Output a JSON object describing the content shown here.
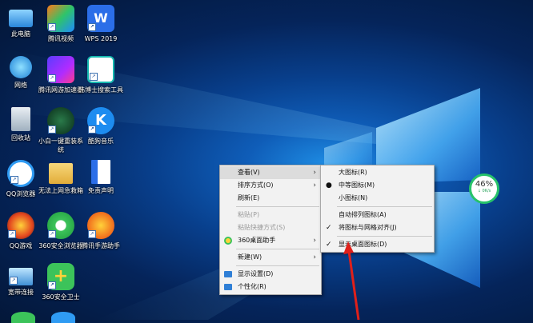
{
  "desktop_icons": [
    {
      "label": "此电脑"
    },
    {
      "label": "腾讯视频"
    },
    {
      "label": "WPS 2019"
    },
    {
      "label": "网络"
    },
    {
      "label": "腾讯网游加速器"
    },
    {
      "label": "韩博士搜索工具"
    },
    {
      "label": "回收站"
    },
    {
      "label": "小白一键重装系统"
    },
    {
      "label": "酷狗音乐"
    },
    {
      "label": "QQ浏览器"
    },
    {
      "label": "无法上网急救箱"
    },
    {
      "label": "免责声明"
    },
    {
      "label": "QQ游戏"
    },
    {
      "label": "360安全浏览器"
    },
    {
      "label": "腾讯手游助手"
    },
    {
      "label": "宽带连接"
    },
    {
      "label": "360安全卫士"
    }
  ],
  "context_menu": {
    "items": [
      {
        "label": "查看(V)"
      },
      {
        "label": "排序方式(O)"
      },
      {
        "label": "刷新(E)"
      },
      {
        "label": "粘贴(P)"
      },
      {
        "label": "粘贴快捷方式(S)"
      },
      {
        "label": "360桌面助手"
      },
      {
        "label": "新建(W)"
      },
      {
        "label": "显示设置(D)"
      },
      {
        "label": "个性化(R)"
      }
    ]
  },
  "view_submenu": {
    "items": [
      {
        "label": "大图标(R)"
      },
      {
        "label": "中等图标(M)"
      },
      {
        "label": "小图标(N)"
      },
      {
        "label": "自动排列图标(A)"
      },
      {
        "label": "将图标与网格对齐(J)"
      },
      {
        "label": "显示桌面图标(D)"
      }
    ]
  },
  "net_widget": {
    "percent": "46%",
    "speed": "0K/s"
  },
  "colors": {
    "annotation_arrow": "#e0201a",
    "widget_ring": "#27c36a"
  }
}
